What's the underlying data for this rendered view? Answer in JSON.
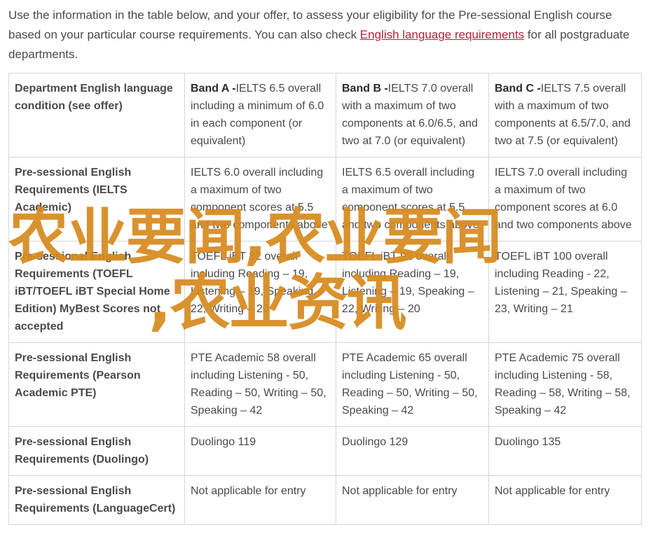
{
  "intro": {
    "text_before": "Use the information in the table below, and your offer, to assess your eligibility for the Pre-sessional English course based on your particular course requirements. You can also check ",
    "link_text": "English language requirements",
    "text_after": " for all postgraduate departments."
  },
  "table": {
    "header": {
      "label": "Department English language condition (see offer)",
      "bands": [
        {
          "title": "Band A -",
          "detail": "IELTS 6.5 overall including a minimum of 6.0 in each component (or equivalent)"
        },
        {
          "title": "Band B -",
          "detail": "IELTS 7.0 overall with a maximum of two components at 6.0/6.5, and two at 7.0 (or equivalent)"
        },
        {
          "title": "Band C -",
          "detail": "IELTS 7.5 overall with a maximum of two components at 6.5/7.0, and two at 7.5 (or equivalent)"
        }
      ]
    },
    "rows": [
      {
        "label": "Pre-sessional English Requirements (IELTS Academic)",
        "cells": [
          "IELTS 6.0 overall including a maximum of two component scores at 5.5 and two components above",
          "IELTS 6.5 overall including a maximum of two component scores at 5.5 and two components above",
          "IELTS 7.0 overall including a maximum of two component scores at 6.0 and two components above"
        ]
      },
      {
        "label": "Pre-sessional English Requirements (TOEFL iBT/TOEFL iBT Special Home Edition) MyBest Scores not accepted",
        "cells": [
          "TOEFL iBT 82 overall including Reading – 19, Listening – 19, Speaking – 22, Writing – 20",
          "TOEFL iBT 92 overall including Reading – 19, Listening – 19, Speaking – 22, Writing – 20",
          "TOEFL iBT 100 overall including Reading - 22, Listening – 21, Speaking – 23, Writing – 21"
        ]
      },
      {
        "label": "Pre-sessional English Requirements (Pearson Academic PTE)",
        "cells": [
          "PTE Academic 58 overall including Listening - 50, Reading – 50, Writing – 50, Speaking – 42",
          "PTE Academic 65 overall including Listening - 50, Reading – 50, Writing – 50, Speaking – 42",
          "PTE Academic 75 overall including Listening - 58, Reading – 58, Writing – 58, Speaking – 42"
        ]
      },
      {
        "label": "Pre-sessional English Requirements (Duolingo)",
        "cells": [
          "Duolingo 119",
          "Duolingo 129",
          "Duolingo 135"
        ]
      },
      {
        "label": "Pre-sessional English Requirements (LanguageCert)",
        "cells": [
          "Not applicable for entry",
          "Not applicable for entry",
          "Not applicable for entry"
        ]
      }
    ]
  },
  "watermark": {
    "line1": "农业要闻,农业要闻",
    "line2": ",农业资讯"
  },
  "colors": {
    "link": "#b51e3a",
    "watermark": "#d68a1e",
    "border": "#d6d6d6"
  }
}
